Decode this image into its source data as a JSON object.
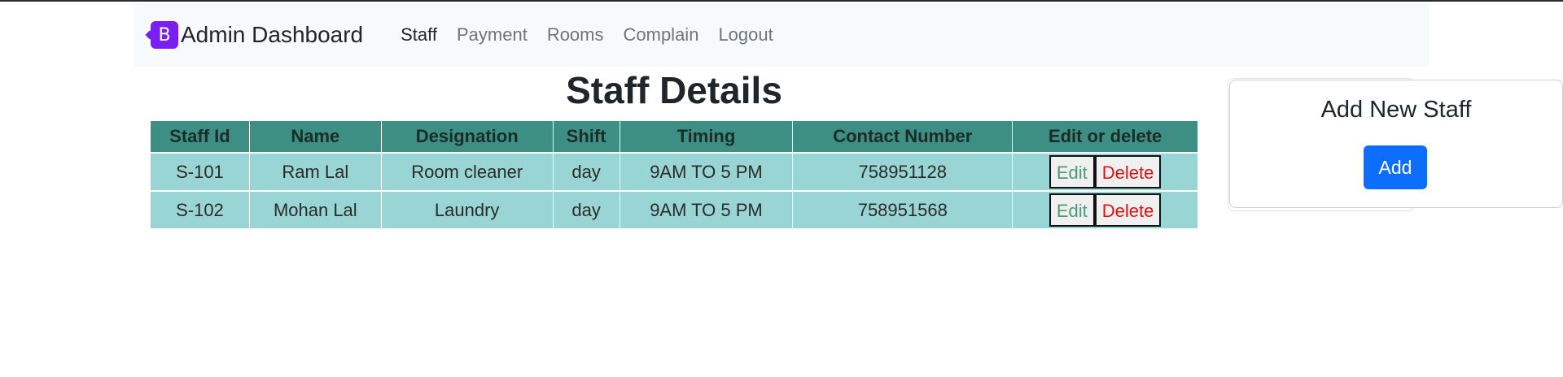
{
  "navbar": {
    "brand_logo_letter": "B",
    "brand_text": "Admin Dashboard",
    "links": [
      {
        "label": "Staff",
        "active": true
      },
      {
        "label": "Payment",
        "active": false
      },
      {
        "label": "Rooms",
        "active": false
      },
      {
        "label": "Complain",
        "active": false
      },
      {
        "label": "Logout",
        "active": false
      }
    ]
  },
  "main": {
    "title": "Staff Details",
    "table": {
      "headers": [
        "Staff Id",
        "Name",
        "Designation",
        "Shift",
        "Timing",
        "Contact Number",
        "Edit or delete"
      ],
      "rows": [
        {
          "id": "S-101",
          "name": "Ram Lal",
          "designation": "Room cleaner",
          "shift": "day",
          "timing": "9AM TO 5 PM",
          "contact": "758951128",
          "edit_label": "Edit",
          "delete_label": "Delete"
        },
        {
          "id": "S-102",
          "name": "Mohan Lal",
          "designation": "Laundry",
          "shift": "day",
          "timing": "9AM TO 5 PM",
          "contact": "758951568",
          "edit_label": "Edit",
          "delete_label": "Delete"
        }
      ]
    }
  },
  "side_card": {
    "title": "Add New Staff",
    "add_label": "Add"
  },
  "colors": {
    "header_bg": "#3d8f84",
    "row_bg": "#98d5d4",
    "brand": "#7a1ff2",
    "primary": "#0d6efd",
    "delete_text": "#e01010",
    "edit_text": "#4c9a7c"
  },
  "icons": {
    "brand_logo": "bootstrap-logo-icon"
  }
}
